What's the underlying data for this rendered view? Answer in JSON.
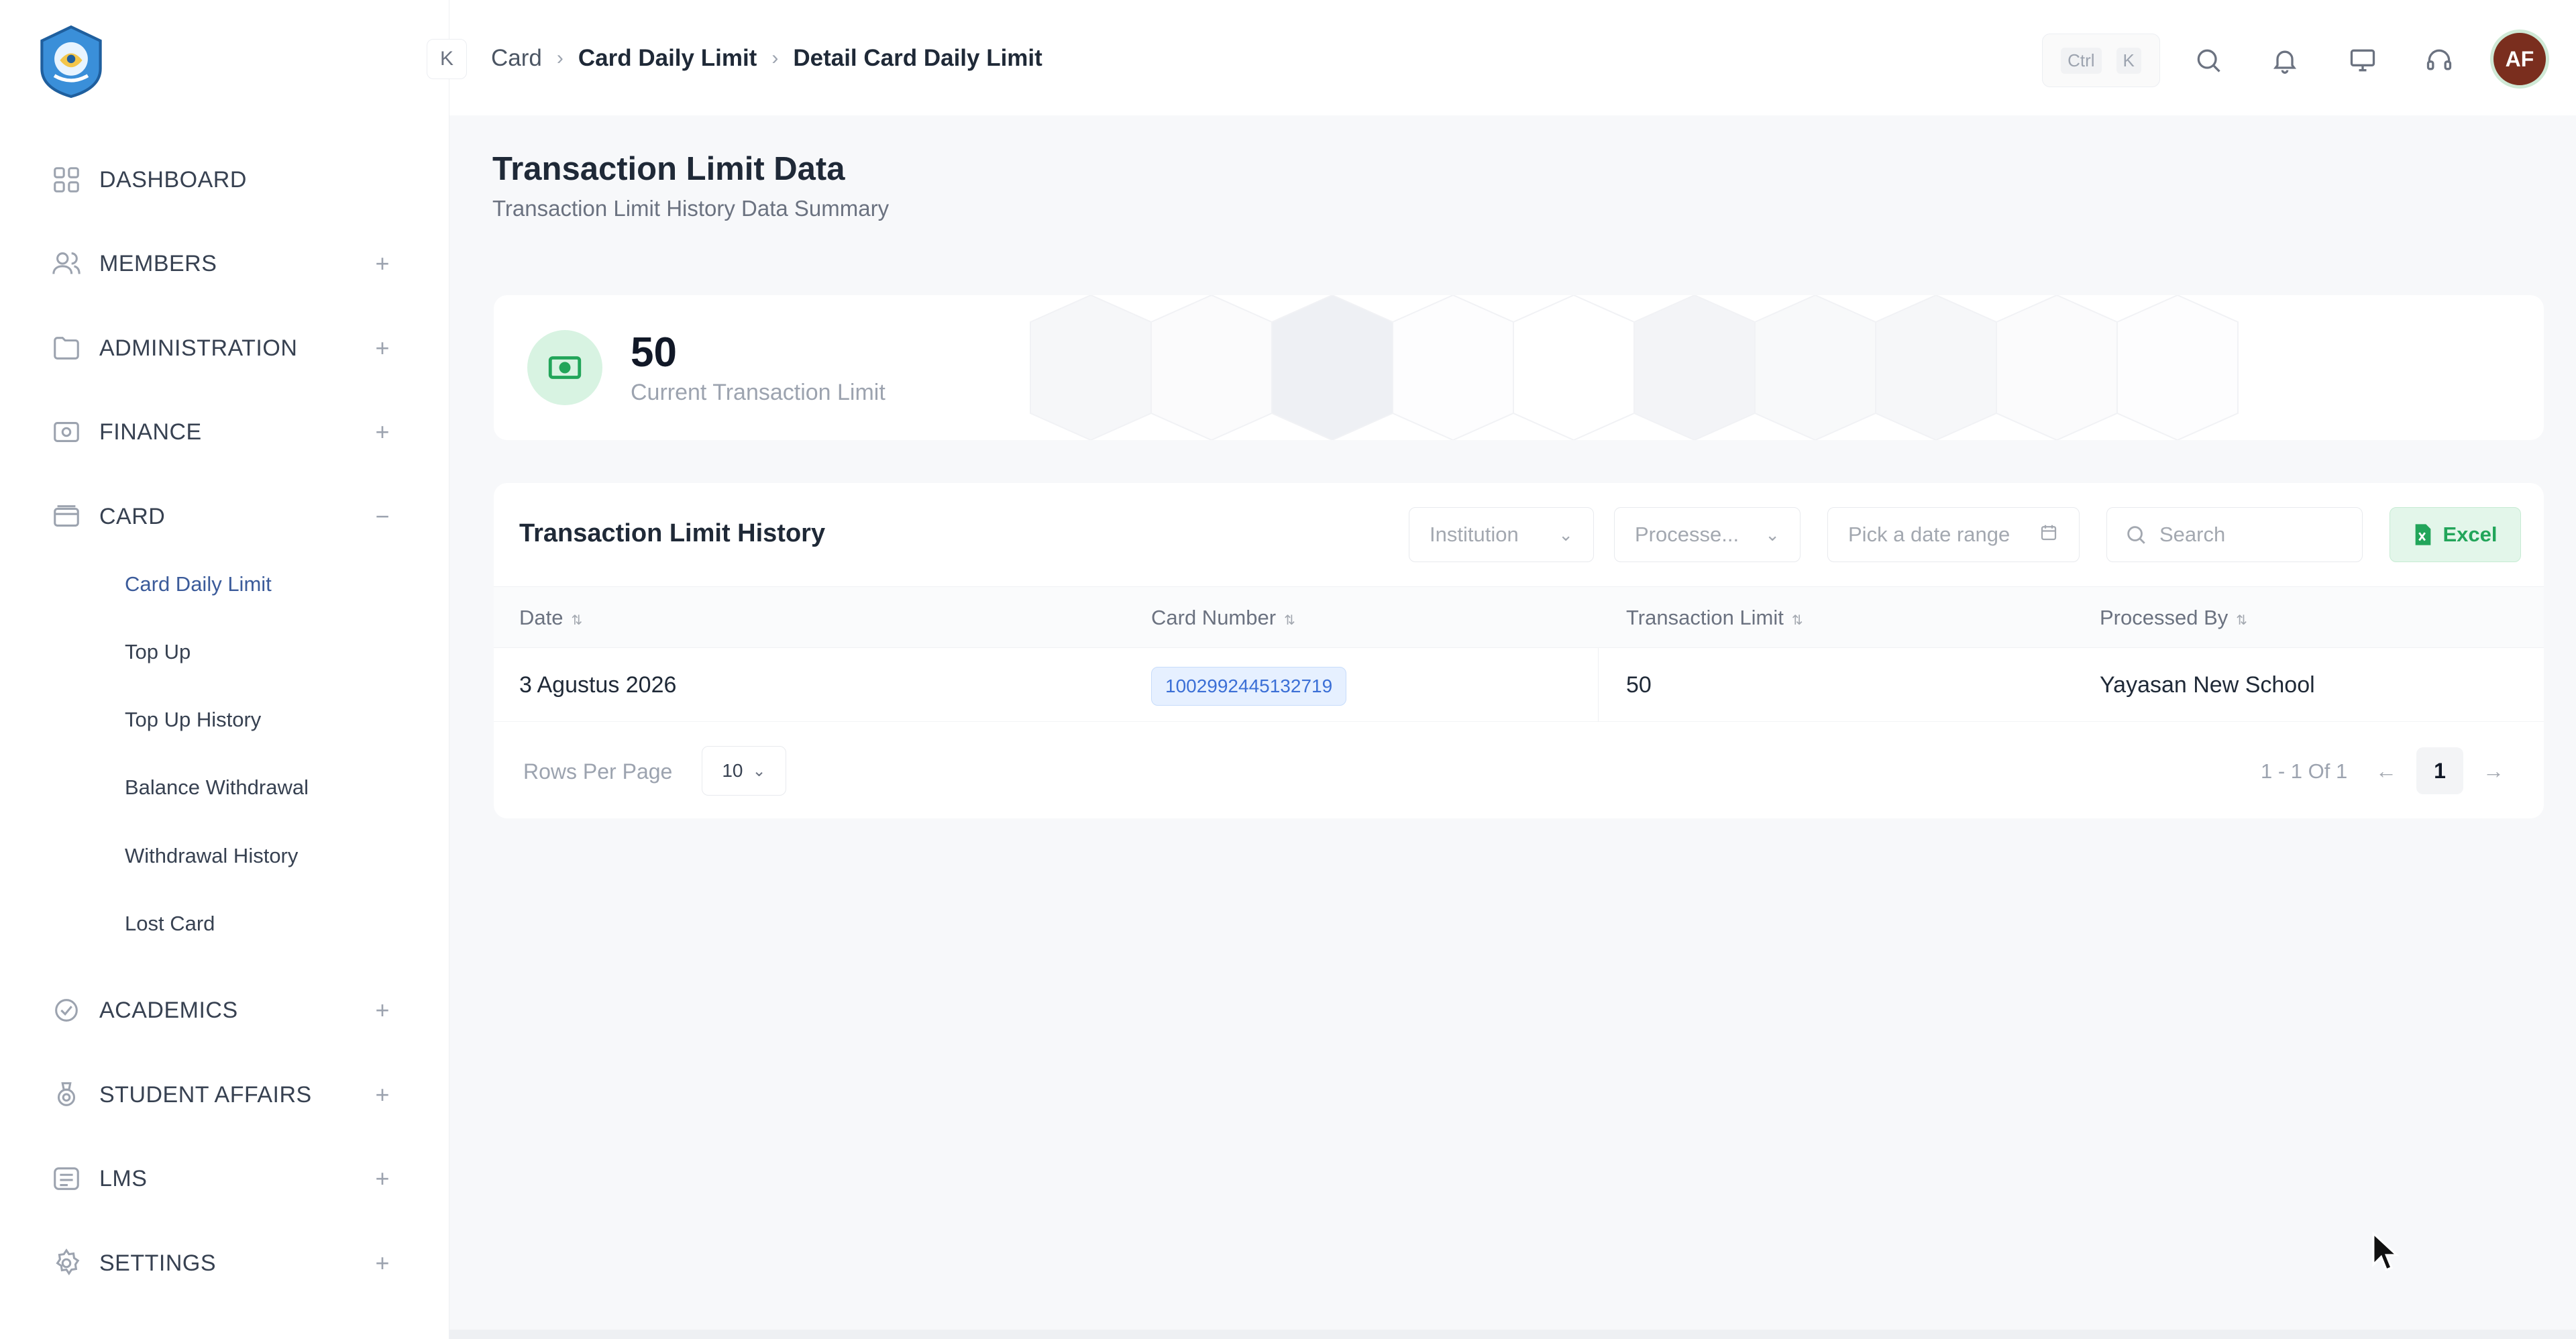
{
  "sidebar": {
    "items": [
      {
        "label": "DASHBOARD",
        "icon": "grid-icon",
        "toggle": ""
      },
      {
        "label": "MEMBERS",
        "icon": "users-icon",
        "toggle": "+"
      },
      {
        "label": "ADMINISTRATION",
        "icon": "folder-icon",
        "toggle": "+"
      },
      {
        "label": "FINANCE",
        "icon": "wallet-icon",
        "toggle": "+"
      },
      {
        "label": "CARD",
        "icon": "card-icon",
        "toggle": "−"
      },
      {
        "label": "ACADEMICS",
        "icon": "academics-icon",
        "toggle": "+"
      },
      {
        "label": "STUDENT AFFAIRS",
        "icon": "badge-icon",
        "toggle": "+"
      },
      {
        "label": "LMS",
        "icon": "list-icon",
        "toggle": "+"
      },
      {
        "label": "SETTINGS",
        "icon": "gear-icon",
        "toggle": "+"
      }
    ],
    "card_subitems": [
      "Card Daily Limit",
      "Top Up",
      "Top Up History",
      "Balance Withdrawal",
      "Withdrawal History",
      "Lost Card"
    ],
    "active_subitem": "Card Daily Limit"
  },
  "topbar": {
    "collapse_glyph": "K",
    "breadcrumb": [
      "Card",
      "Card Daily Limit",
      "Detail Card Daily Limit"
    ],
    "shortcut_keys": [
      "Ctrl",
      "K"
    ],
    "avatar_initials": "AF"
  },
  "page": {
    "title": "Transaction Limit Data",
    "subtitle": "Transaction Limit History Data Summary"
  },
  "stat": {
    "value": "50",
    "label": "Current Transaction Limit"
  },
  "history": {
    "title": "Transaction Limit History",
    "filters": {
      "institution": "Institution",
      "processed": "Processe...",
      "date_range": "Pick a date range",
      "search_placeholder": "Search"
    },
    "excel_label": "Excel",
    "columns": [
      "Date",
      "Card Number",
      "Transaction Limit",
      "Processed By"
    ],
    "rows": [
      {
        "date": "3 Agustus 2026",
        "card_number": "1002992445132719",
        "limit": "50",
        "processed_by": "Yayasan New School"
      }
    ],
    "rows_per_page_label": "Rows Per Page",
    "rows_per_page": "10",
    "range_text": "1 - 1 Of 1",
    "current_page": "1"
  },
  "colors": {
    "accent_green": "#22a55a",
    "badge_blue": "#3b6fd6",
    "active_link": "#3b5b9a",
    "avatar_bg": "#7a2e1e"
  }
}
